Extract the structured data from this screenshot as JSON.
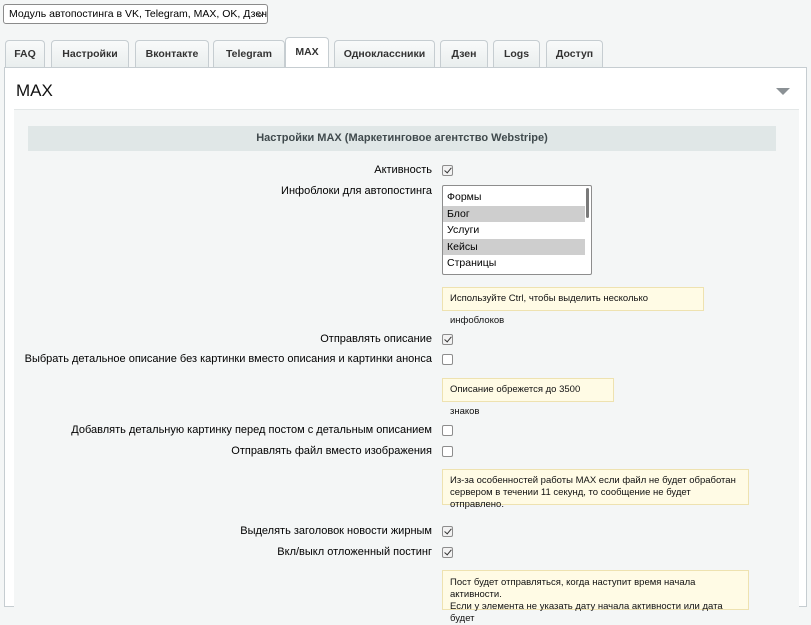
{
  "module_select": {
    "value": "Модуль автопостинга в VK, Telegram, MAX, OK, Дзен"
  },
  "tabs": [
    {
      "label": "FAQ"
    },
    {
      "label": "Настройки"
    },
    {
      "label": "Вконтакте"
    },
    {
      "label": "Telegram"
    },
    {
      "label": "MAX"
    },
    {
      "label": "Одноклассники"
    },
    {
      "label": "Дзен"
    },
    {
      "label": "Logs"
    },
    {
      "label": "Доступ"
    }
  ],
  "active_tab": "MAX",
  "panel": {
    "title": "MAX",
    "section_title": "Настройки MAX (Маркетинговое агентство Webstripe)"
  },
  "fields": {
    "active": {
      "label": "Активность",
      "checked": true
    },
    "iblocks": {
      "label": "Инфоблоки для автопостинга",
      "options": [
        {
          "text": "Формы",
          "selected": false
        },
        {
          "text": "Блог",
          "selected": true
        },
        {
          "text": "Услуги",
          "selected": false
        },
        {
          "text": "Кейсы",
          "selected": true
        },
        {
          "text": "Страницы",
          "selected": false
        }
      ],
      "hint": "Используйте Ctrl, чтобы выделить несколько инфоблоков"
    },
    "send_description": {
      "label": "Отправлять описание",
      "checked": true
    },
    "detail_description": {
      "label": "Выбрать детальное описание без картинки вместо описания и картинки анонса",
      "checked": false,
      "hint": "Описание обрежется до 3500 знаков"
    },
    "detail_picture": {
      "label": "Добавлять детальную картинку перед постом с детальным описанием",
      "checked": false
    },
    "send_file": {
      "label": "Отправлять файл вместо изображения",
      "checked": false,
      "hint_line1": "Из-за особенностей работы MAX если файл не будет обработан",
      "hint_line2": "сервером в течении 11 секунд, то сообщение не будет отправлено."
    },
    "bold_title": {
      "label": "Выделять заголовок новости жирным",
      "checked": true
    },
    "delayed_posting": {
      "label": "Вкл/выкл отложенный постинг",
      "checked": true,
      "hint_line1": "Пост будет отправляться, когда наступит время начала активности.",
      "hint_line2": "Если у элемента не указать дату начала активности или дата будет"
    }
  }
}
